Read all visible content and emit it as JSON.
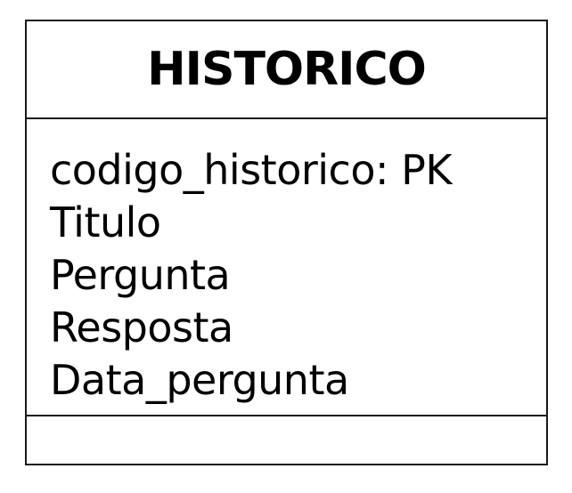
{
  "class": {
    "name": "HISTORICO",
    "attributes": [
      "codigo_historico: PK",
      "Titulo",
      "Pergunta",
      "Resposta",
      "Data_pergunta"
    ],
    "methods": []
  },
  "colors": {
    "border": "#1a1a1a",
    "text": "#000000",
    "background": "#ffffff"
  }
}
